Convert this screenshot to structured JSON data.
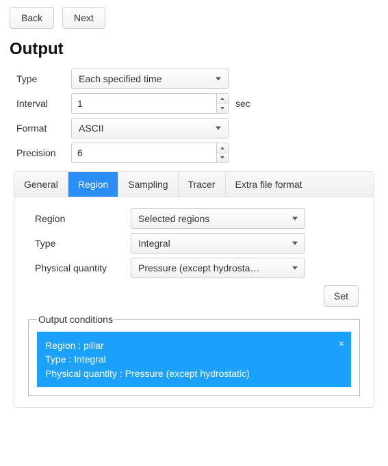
{
  "nav": {
    "back": "Back",
    "next": "Next"
  },
  "heading": "Output",
  "form": {
    "type_label": "Type",
    "type_value": "Each specified time",
    "interval_label": "Interval",
    "interval_value": "1",
    "interval_unit": "sec",
    "format_label": "Format",
    "format_value": "ASCII",
    "precision_label": "Precision",
    "precision_value": "6"
  },
  "tabs": {
    "general": "General",
    "region": "Region",
    "sampling": "Sampling",
    "tracer": "Tracer",
    "extra": "Extra file format",
    "active": "region"
  },
  "region_tab": {
    "region_label": "Region",
    "region_value": "Selected regions",
    "type_label": "Type",
    "type_value": "Integral",
    "pq_label": "Physical quantity",
    "pq_value": "Pressure (except hydrosta…",
    "set_btn": "Set"
  },
  "conditions": {
    "legend": "Output conditions",
    "item": {
      "line1": "Region : pillar",
      "line2": "Type : Integral",
      "line3": "Physical quantity : Pressure (except hydrostatic)"
    }
  }
}
